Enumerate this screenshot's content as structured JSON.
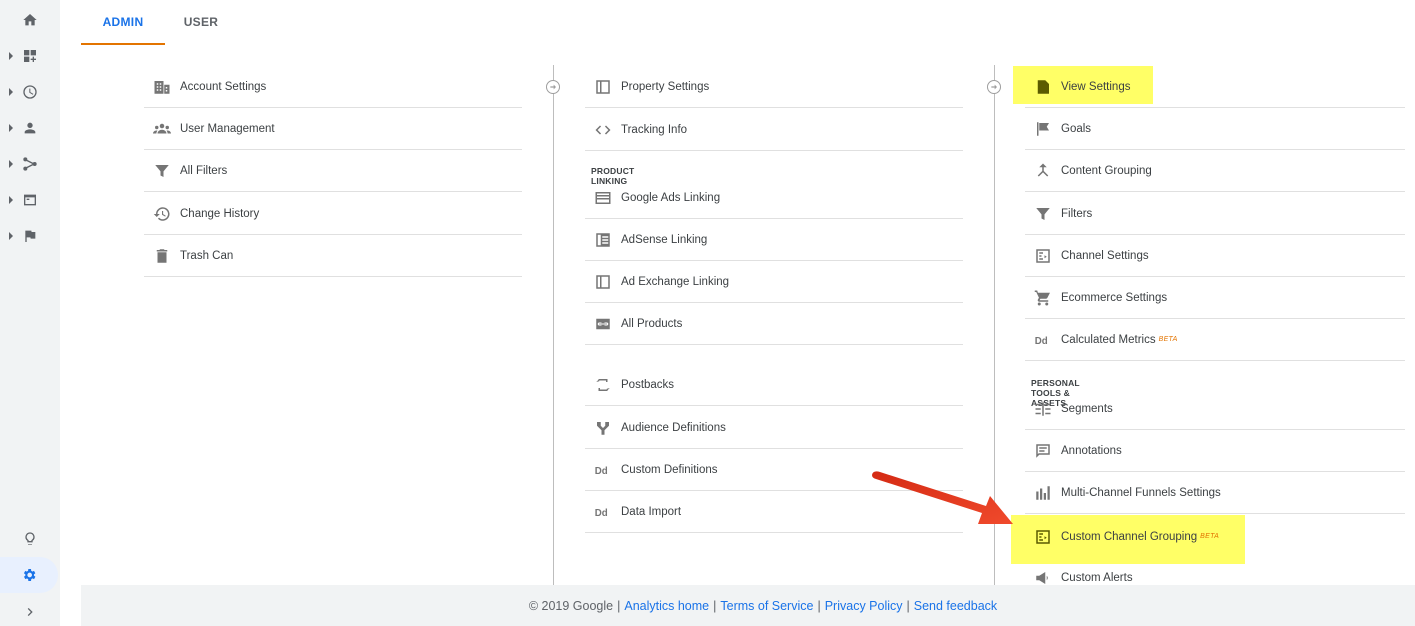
{
  "tabs": {
    "admin": "ADMIN",
    "user": "USER"
  },
  "account": {
    "items": [
      {
        "label": "Account Settings",
        "icon": "building-icon"
      },
      {
        "label": "User Management",
        "icon": "people-icon"
      },
      {
        "label": "All Filters",
        "icon": "filter-icon"
      },
      {
        "label": "Change History",
        "icon": "history-icon"
      },
      {
        "label": "Trash Can",
        "icon": "trash-icon"
      }
    ]
  },
  "property": {
    "items_top": [
      {
        "label": "Property Settings",
        "icon": "window-icon"
      },
      {
        "label": "Tracking Info",
        "icon": "code-icon"
      }
    ],
    "section_product_linking": "PRODUCT LINKING",
    "items_linking": [
      {
        "label": "Google Ads Linking",
        "icon": "ads-icon"
      },
      {
        "label": "AdSense Linking",
        "icon": "adsense-icon"
      },
      {
        "label": "Ad Exchange Linking",
        "icon": "window-icon"
      },
      {
        "label": "All Products",
        "icon": "link-icon"
      }
    ],
    "items_bottom": [
      {
        "label": "Postbacks",
        "icon": "swap-icon"
      },
      {
        "label": "Audience Definitions",
        "icon": "fork-icon"
      },
      {
        "label": "Custom Definitions",
        "icon": "dd-icon"
      },
      {
        "label": "Data Import",
        "icon": "dd-icon"
      }
    ]
  },
  "view": {
    "items_top": [
      {
        "label": "View Settings",
        "icon": "doc-icon"
      },
      {
        "label": "Goals",
        "icon": "flag-icon"
      },
      {
        "label": "Content Grouping",
        "icon": "merge-icon"
      },
      {
        "label": "Filters",
        "icon": "filter-icon"
      },
      {
        "label": "Channel Settings",
        "icon": "channel-icon"
      },
      {
        "label": "Ecommerce Settings",
        "icon": "cart-icon"
      },
      {
        "label": "Calculated Metrics",
        "icon": "dd-icon",
        "badge": "BETA"
      }
    ],
    "section_personal": "PERSONAL TOOLS & ASSETS",
    "items_personal": [
      {
        "label": "Segments",
        "icon": "segments-icon"
      },
      {
        "label": "Annotations",
        "icon": "comment-icon"
      },
      {
        "label": "Multi-Channel Funnels Settings",
        "icon": "bars-icon"
      },
      {
        "label": "Custom Channel Grouping",
        "icon": "channel-icon",
        "badge": "BETA"
      },
      {
        "label": "Custom Alerts",
        "icon": "megaphone-icon"
      }
    ]
  },
  "footer": {
    "copyright": "© 2019 Google",
    "links": [
      "Analytics home",
      "Terms of Service",
      "Privacy Policy",
      "Send feedback"
    ]
  },
  "colors": {
    "accent": "#1a73e8",
    "tab_underline": "#e37400",
    "highlight": "#ffff66",
    "annotation_arrow": "#e5331c"
  }
}
